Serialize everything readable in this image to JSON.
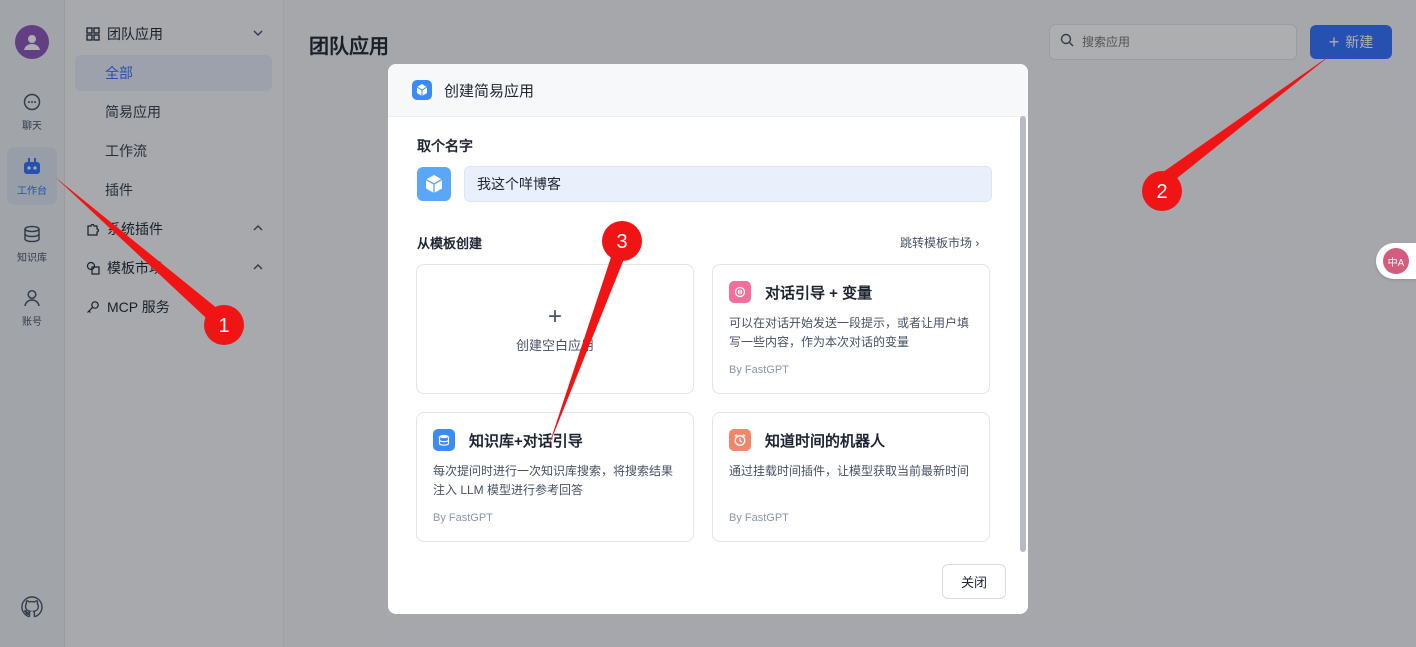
{
  "rail": {
    "items": [
      {
        "label": "聊天",
        "icon": "chat-icon"
      },
      {
        "label": "工作台",
        "icon": "robot-icon"
      },
      {
        "label": "知识库",
        "icon": "database-icon"
      },
      {
        "label": "账号",
        "icon": "user-icon"
      }
    ],
    "active_index": 1
  },
  "subnav": {
    "team_apps": {
      "label": "团队应用",
      "items": [
        "全部",
        "简易应用",
        "工作流",
        "插件"
      ]
    },
    "system_plugins": {
      "label": "系统插件"
    },
    "template_market": {
      "label": "模板市场"
    },
    "mcp": {
      "label": "MCP 服务"
    }
  },
  "header": {
    "title": "团队应用",
    "search_placeholder": "搜索应用",
    "new_label": "新建"
  },
  "modal": {
    "title": "创建简易应用",
    "name_label": "取个名字",
    "name_value": "我这个咩博客",
    "from_template_label": "从模板创建",
    "market_link": "跳转模板市场",
    "blank_label": "创建空白应用",
    "templates": [
      {
        "title": "对话引导 + 变量",
        "desc": "可以在对话开始发送一段提示，或者让用户填写一些内容，作为本次对话的变量",
        "by": "By FastGPT",
        "icon": "chat-guide-icon",
        "color": "#f36f9a"
      },
      {
        "title": "知识库+对话引导",
        "desc": "每次提问时进行一次知识库搜索，将搜索结果注入 LLM 模型进行参考回答",
        "by": "By FastGPT",
        "icon": "dataset-icon",
        "color": "#3a8bf5"
      },
      {
        "title": "知道时间的机器人",
        "desc": "通过挂载时间插件，让模型获取当前最新时间",
        "by": "By FastGPT",
        "icon": "clock-icon",
        "color": "#f0876d"
      }
    ],
    "close_label": "关闭"
  },
  "annotations": [
    "1",
    "2",
    "3"
  ],
  "colors": {
    "accent": "#3370ff",
    "annotation": "#f01414"
  },
  "translate_badge": "中A"
}
